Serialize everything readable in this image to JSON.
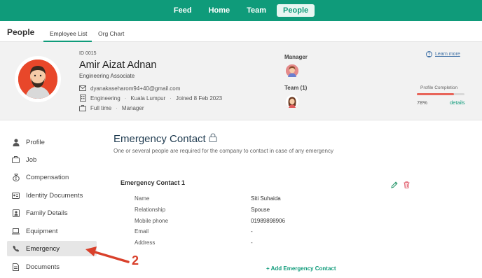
{
  "topnav": {
    "items": [
      {
        "label": "Feed"
      },
      {
        "label": "Home"
      },
      {
        "label": "Team"
      },
      {
        "label": "People"
      }
    ]
  },
  "subnav": {
    "title": "People",
    "tabs": [
      {
        "label": "Employee List"
      },
      {
        "label": "Org Chart"
      }
    ]
  },
  "profile": {
    "id": "ID 0015",
    "name": "Amir Aizat Adnan",
    "role": "Engineering Associate",
    "email": "dyanakaseharom94+40@gmail.com",
    "department": "Engineering",
    "location": "Kuala Lumpur",
    "joined": "Joined 8 Feb 2023",
    "employment_type": "Full time",
    "position": "Manager",
    "manager_label": "Manager",
    "team_label": "Team (1)",
    "learn_more": "Learn more",
    "completion_label": "Profile Completion",
    "completion_pct": "78%",
    "completion_value": 0.78,
    "details_link": "details",
    "avatar_color": "#e8472a"
  },
  "sidebar": {
    "items": [
      {
        "label": "Profile",
        "icon": "person-icon"
      },
      {
        "label": "Job",
        "icon": "briefcase-icon"
      },
      {
        "label": "Compensation",
        "icon": "money-bag-icon"
      },
      {
        "label": "Identity Documents",
        "icon": "id-card-icon"
      },
      {
        "label": "Family Details",
        "icon": "family-icon"
      },
      {
        "label": "Equipment",
        "icon": "laptop-icon"
      },
      {
        "label": "Emergency",
        "icon": "phone-icon"
      },
      {
        "label": "Documents",
        "icon": "document-icon"
      }
    ]
  },
  "main": {
    "title": "Emergency Contact",
    "subtitle": "One or several people are required for the company to contact in case of any emergency",
    "contact_title": "Emergency Contact 1",
    "fields": [
      {
        "label": "Name",
        "value": "Siti Suhaida"
      },
      {
        "label": "Relationship",
        "value": "Spouse"
      },
      {
        "label": "Mobile phone",
        "value": "01989898906"
      },
      {
        "label": "Email",
        "value": "-"
      },
      {
        "label": "Address",
        "value": "-"
      }
    ],
    "add_button": "+ Add Emergency Contact"
  },
  "annotation": {
    "number": "2",
    "color": "#d9402b"
  },
  "colors": {
    "brand": "#0f9b7a",
    "danger": "#e8655a"
  }
}
